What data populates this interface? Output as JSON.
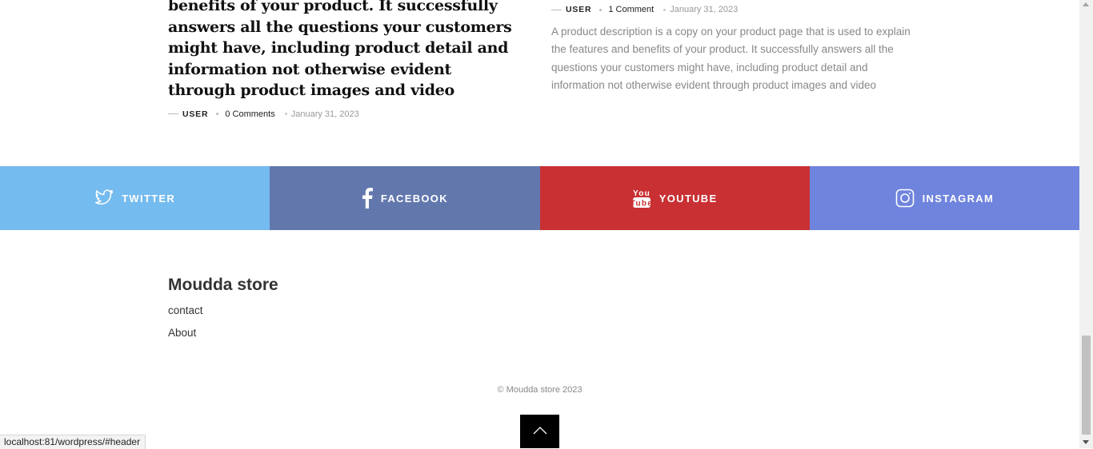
{
  "posts": {
    "left": {
      "title": "benefits of your product. It successfully answers all the questions your customers might have, including product detail and information not otherwise evident through product images and video",
      "author": "USER",
      "comments": "0 Comments",
      "date": "January 31, 2023"
    },
    "right": {
      "author": "USER",
      "comments": "1 Comment",
      "date": "January 31, 2023",
      "excerpt": "A product description is a copy on your product page that is used to explain the features and benefits of your product. It successfully answers all the questions your customers might have, including product detail and information not otherwise evident through product images and video"
    }
  },
  "social": [
    {
      "label": "TWITTER",
      "icon": "twitter-bird-icon",
      "color": "#74bbef"
    },
    {
      "label": "FACEBOOK",
      "icon": "facebook-f-icon",
      "color": "#6278ad"
    },
    {
      "label": "YOUTUBE",
      "icon": "youtube-icon",
      "color": "#c93034"
    },
    {
      "label": "INSTAGRAM",
      "icon": "instagram-icon",
      "color": "#6f84dd"
    }
  ],
  "footer": {
    "title": "Moudda store",
    "links": [
      "contact",
      "About"
    ],
    "copyright": "© Moudda store 2023"
  },
  "status_url": "localhost:81/wordpress/#header"
}
